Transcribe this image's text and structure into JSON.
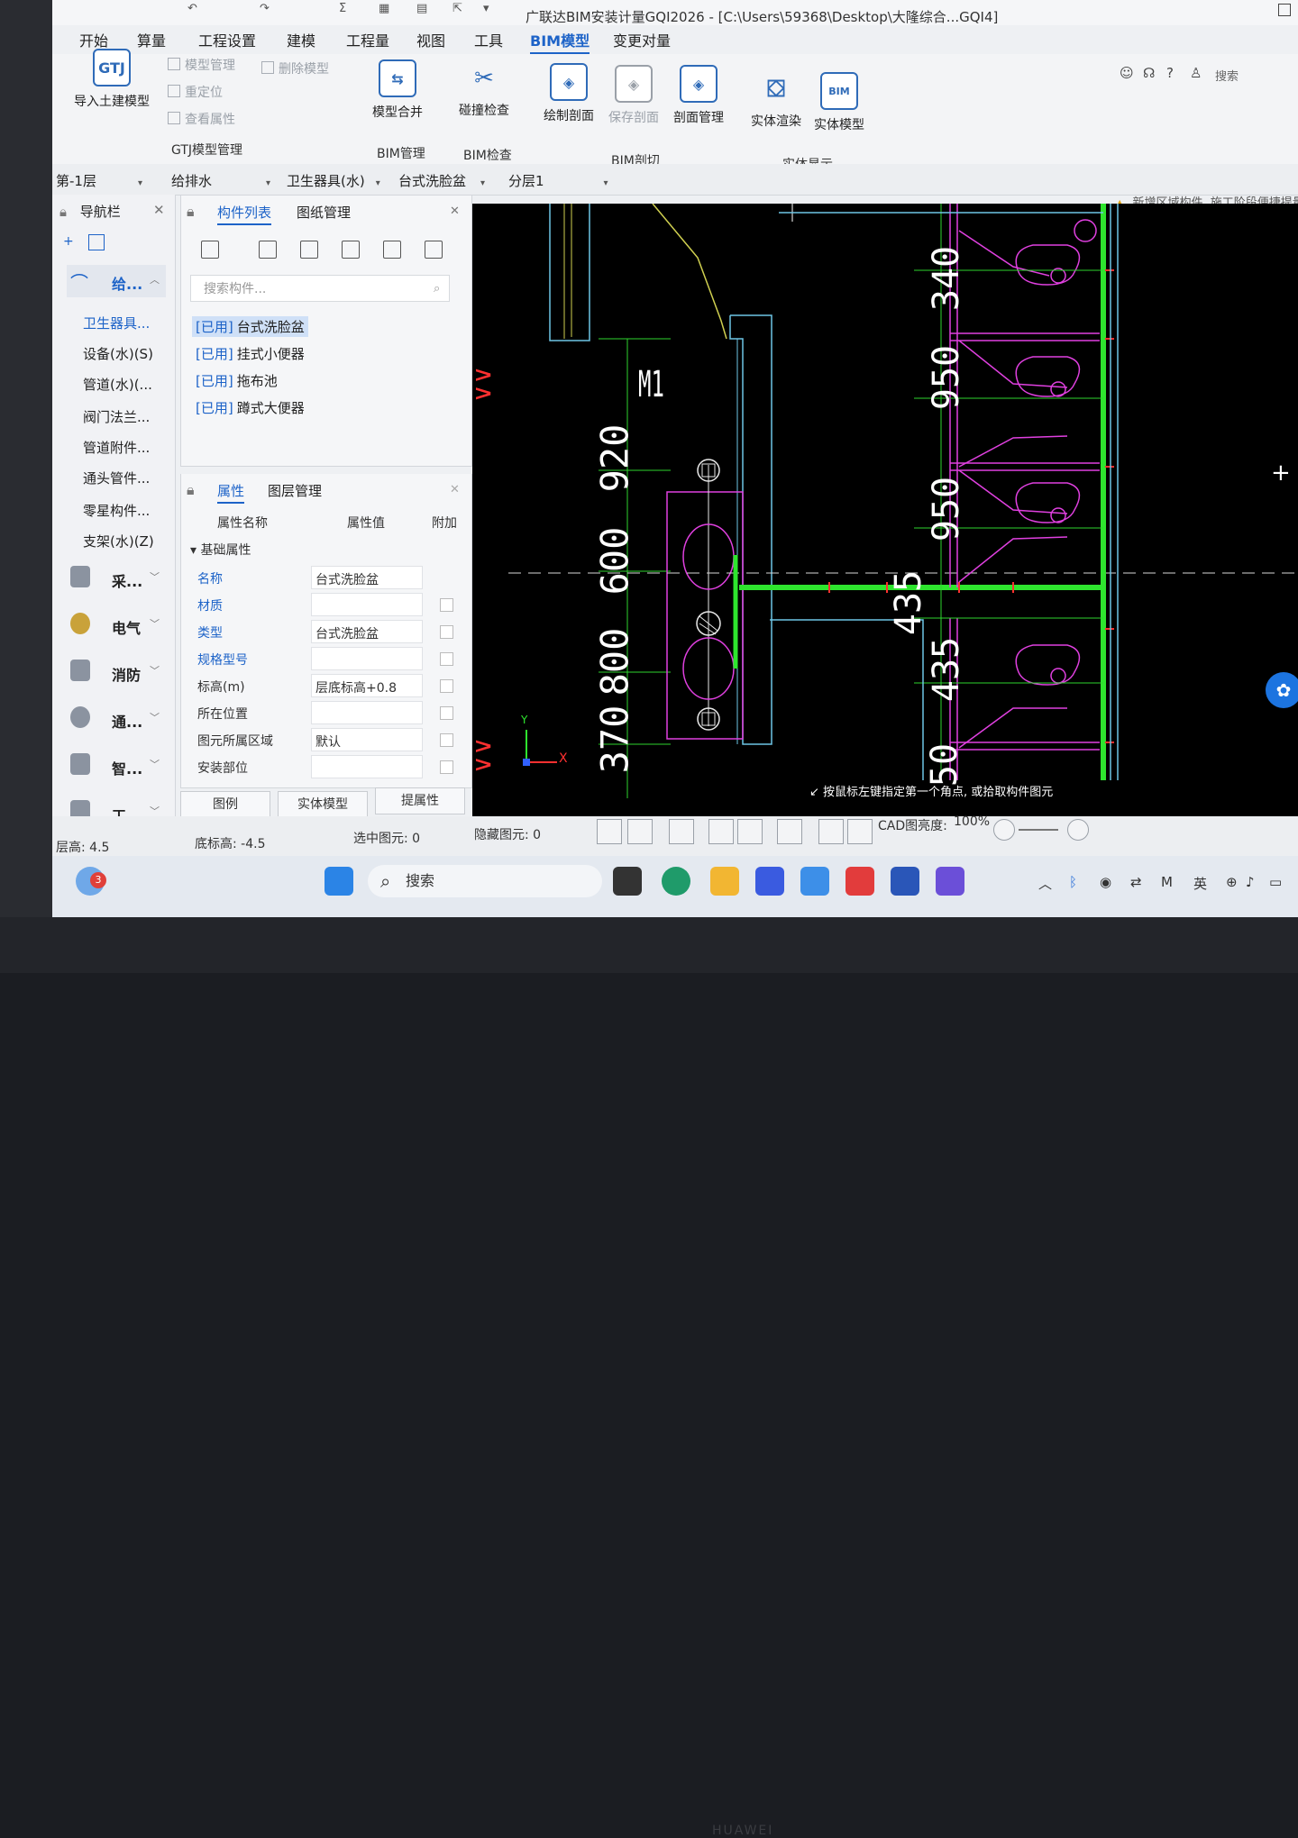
{
  "title": "广联达BIM安装计量GQI2026 - [C:\\Users\\59368\\Desktop\\大隆综合...GQI4]",
  "menu": [
    "开始",
    "算量",
    "工程设置",
    "建模",
    "工程量",
    "视图",
    "工具",
    "BIM模型",
    "变更对量"
  ],
  "ribbon": {
    "import": "导入土建模型",
    "model_manage": "模型管理",
    "delete_model": "删除模型",
    "relocate": "重定位",
    "view_attr": "查看属性",
    "group_gtj": "GTJ模型管理",
    "merge": "模型合并",
    "group_bim_manage": "BIM管理",
    "collision": "碰撞检查",
    "group_bim_check": "BIM检查",
    "draw_section": "绘制剖面",
    "save_section": "保存剖面",
    "section_manage": "剖面管理",
    "group_bim_cut": "BIM剖切",
    "render": "实体渲染",
    "solid_model": "实体模型",
    "group_display": "实体显示",
    "search": "搜索"
  },
  "selectors": [
    "第-1层",
    "给排水",
    "卫生器具(水)",
    "台式洗脸盆",
    "分层1"
  ],
  "notice": "新增区域构件, 施工阶段便捷提量等",
  "nav": {
    "title": "导航栏",
    "category": "给...",
    "items": [
      "卫生器具...",
      "设备(水)(S)",
      "管道(水)(...",
      "阀门法兰...",
      "管道附件...",
      "通头管件...",
      "零星构件...",
      "支架(水)(Z)"
    ],
    "cats": [
      "采...",
      "电气",
      "消防",
      "通...",
      "智...",
      "工..."
    ]
  },
  "comp_panel": {
    "tab1": "构件列表",
    "tab2": "图纸管理",
    "search_placeholder": "搜索构件...",
    "items": [
      {
        "tag": "[已用]",
        "name": "台式洗脸盆"
      },
      {
        "tag": "[已用]",
        "name": "挂式小便器"
      },
      {
        "tag": "[已用]",
        "name": "拖布池"
      },
      {
        "tag": "[已用]",
        "name": "蹲式大便器"
      }
    ]
  },
  "prop_panel": {
    "tab1": "属性",
    "tab2": "图层管理",
    "col_name": "属性名称",
    "col_value": "属性值",
    "col_extra": "附加",
    "group": "基础属性",
    "rows": [
      {
        "k": "名称",
        "v": "台式洗脸盆",
        "blue": true
      },
      {
        "k": "材质",
        "v": "",
        "blue": true
      },
      {
        "k": "类型",
        "v": "台式洗脸盆",
        "blue": true
      },
      {
        "k": "规格型号",
        "v": "",
        "blue": true
      },
      {
        "k": "标高(m)",
        "v": "层底标高+0.8",
        "blue": false
      },
      {
        "k": "所在位置",
        "v": "",
        "blue": false
      },
      {
        "k": "图元所属区域",
        "v": "默认",
        "blue": false
      },
      {
        "k": "安装部位",
        "v": "",
        "blue": false
      }
    ],
    "btn1": "图例",
    "btn2": "实体模型",
    "btn3": "提属性"
  },
  "cad": {
    "label_m1": "M1",
    "dims_left": [
      "920",
      "600",
      "800",
      "370"
    ],
    "dims_right": [
      "340",
      "950",
      "950",
      "435",
      "435",
      "50"
    ],
    "axis_x": "X",
    "axis_y": "Y",
    "prompt": "按鼠标左键指定第一个角点, 或拾取构件图元"
  },
  "status": {
    "floor_height": "层高: 4.5",
    "base_height": "底标高: -4.5",
    "selected": "选中图元: 0",
    "hidden": "隐藏图元: 0",
    "cad_brightness_label": "CAD图亮度:",
    "cad_brightness": "100%"
  },
  "taskbar": {
    "search": "搜索",
    "lang": "英",
    "badge": "3"
  }
}
